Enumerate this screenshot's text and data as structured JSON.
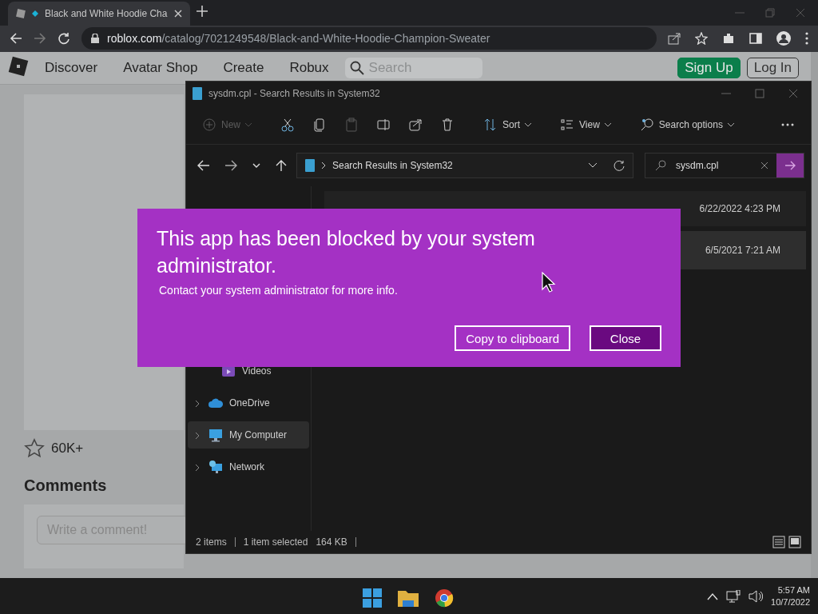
{
  "browser": {
    "tab": {
      "title": "Black and White Hoodie Cha"
    },
    "url_host": "roblox.com",
    "url_path": "/catalog/7021249548/Black-and-White-Hoodie-Champion-Sweater"
  },
  "site_nav": {
    "items": [
      "Discover",
      "Avatar Shop",
      "Create",
      "Robux"
    ],
    "search_placeholder": "Search",
    "buttons": [
      {
        "label": "Sign Up",
        "kind": "primary"
      },
      {
        "label": "Log In",
        "kind": "outline"
      }
    ]
  },
  "item_page": {
    "favorites": "60K+",
    "comments_heading": "Comments",
    "comment_placeholder": "Write a comment!"
  },
  "explorer": {
    "title": "sysdm.cpl - Search Results in System32",
    "toolbar": [
      {
        "kind": "new",
        "label": "New",
        "disabled": true
      },
      {
        "kind": "cut",
        "disabled": false
      },
      {
        "kind": "copy",
        "disabled": false
      },
      {
        "kind": "paste",
        "disabled": true
      },
      {
        "kind": "rename",
        "disabled": false
      },
      {
        "kind": "share",
        "disabled": false
      },
      {
        "kind": "delete",
        "disabled": false
      },
      {
        "kind": "sort",
        "label": "Sort",
        "disabled": false
      },
      {
        "kind": "view",
        "label": "View",
        "disabled": false
      },
      {
        "kind": "search",
        "label": "Search options",
        "disabled": false
      },
      {
        "kind": "more",
        "disabled": false
      }
    ],
    "breadcrumb": "Search Results in System32",
    "search_value": "sysdm.cpl",
    "sidebar": [
      {
        "kind": "videos",
        "label": "Videos",
        "selected": false,
        "expandable": false
      },
      {
        "kind": "cloud",
        "label": "OneDrive",
        "selected": false,
        "expandable": true
      },
      {
        "kind": "computer",
        "label": "My Computer",
        "selected": true,
        "expandable": true
      },
      {
        "kind": "network",
        "label": "Network",
        "selected": false,
        "expandable": true
      }
    ],
    "files": [
      {
        "date": "6/22/2022 4:23 PM",
        "selected": false
      },
      {
        "date": "6/5/2021 7:21 AM",
        "selected": true
      }
    ],
    "status": {
      "count": "2 items",
      "selection": "1 item selected",
      "size": "164 KB"
    }
  },
  "dialog": {
    "title": "This app has been blocked by your system administrator.",
    "message": "Contact your system administrator for more info.",
    "buttons": [
      {
        "label": "Copy to clipboard",
        "kind": "secondary"
      },
      {
        "label": "Close",
        "kind": "primary"
      }
    ]
  },
  "taskbar": {
    "time": "5:57 AM",
    "date": "10/7/2022"
  }
}
